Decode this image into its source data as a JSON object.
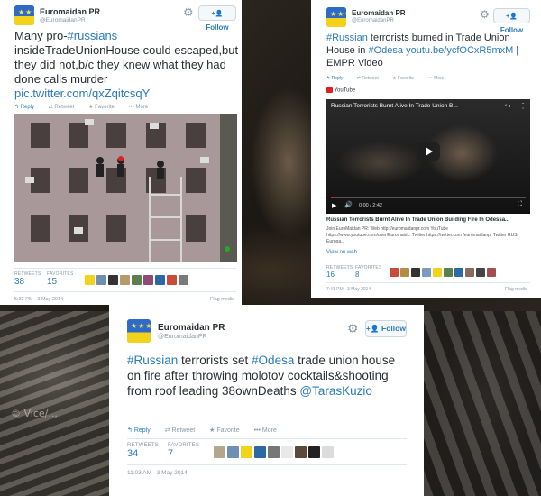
{
  "tweets": [
    {
      "name": "Euromaidan PR",
      "handle": "@EuromaidanPR",
      "follow_label": "Follow",
      "text_plain": "Many pro-",
      "text_tag": "#russians",
      "text_rest": "insideTradeUnionHouse could escaped,but they did not,b/c they knew what they had done calls murder",
      "link": "pic.twitter.com/qxZqitcsqY",
      "actions": [
        "Reply",
        "Retweet",
        "Favorite",
        "More"
      ],
      "retweets_label": "RETWEETS",
      "retweets": "38",
      "favorites_label": "FAVORITES",
      "favorites": "15",
      "time": "5:33 PM - 3 May 2014",
      "flag": "Flag media"
    },
    {
      "name": "Euromaidan PR",
      "handle": "@EuromaidanPR",
      "follow_label": "Follow",
      "t1_tag": "#Russian",
      "t1_a": " terrorists burned in Trade Union House in ",
      "t1_tag2": "#Odesa",
      "t1_link": "youtu.be/ycfOCxR5mxM",
      "t1_b": " | EMPR Video",
      "yt_label": "YouTube",
      "video_title": "Russian Terrorists Burnt Alive In Trade Union B...",
      "video_time": "0:00 / 2:42",
      "card_title": "Russian Terrorists Burnt Alive In Trade Union Building Fire In Odessa...",
      "card_desc": "Join EuroMaidan PR: Web http://euromaidanpr.com YouTube https://www.youtube.com/user/Euromaid... Twitter https://twitter.com /euromaidanpr Twitter RUS: Europa...",
      "view_on_web": "View on web",
      "actions": [
        "Reply",
        "Retweet",
        "Favorite",
        "More"
      ],
      "retweets_label": "RETWEETS",
      "retweets": "16",
      "favorites_label": "FAVORITES",
      "favorites": "8",
      "time": "7:41 PM - 3 May 2014",
      "flag": "Flag media"
    },
    {
      "name": "Euromaidan PR",
      "handle": "@EuromaidanPR",
      "follow_label": "Follow",
      "t_tag": "#Russian",
      "t_a": " terrorists set ",
      "t_tag2": "#Odesa",
      "t_b": " trade union house on fire after throwing molotov cocktails&shooting from roof leading 38ownDeaths ",
      "t_mention": "@TarasKuzio",
      "actions": [
        "Reply",
        "Retweet",
        "Favorite",
        "More"
      ],
      "retweets_label": "RETWEETS",
      "retweets": "34",
      "favorites_label": "FAVORITES",
      "favorites": "7",
      "time": "11:03 AM - 3 May 2014"
    }
  ],
  "watermark": "© Vice/..."
}
